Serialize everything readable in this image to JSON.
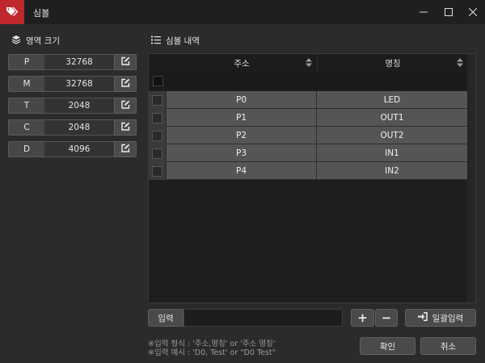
{
  "window": {
    "title": "심볼",
    "accent": "#c0282d"
  },
  "area_section": {
    "title": "영역 크기",
    "rows": [
      {
        "label": "P",
        "value": "32768"
      },
      {
        "label": "M",
        "value": "32768"
      },
      {
        "label": "T",
        "value": "2048"
      },
      {
        "label": "C",
        "value": "2048"
      },
      {
        "label": "D",
        "value": "4096"
      }
    ]
  },
  "symbol_section": {
    "title": "심볼 내역",
    "columns": [
      "주소",
      "명칭"
    ],
    "rows": [
      {
        "address": "P0",
        "name": "LED"
      },
      {
        "address": "P1",
        "name": "OUT1"
      },
      {
        "address": "P2",
        "name": "OUT2"
      },
      {
        "address": "P3",
        "name": "IN1"
      },
      {
        "address": "P4",
        "name": "IN2"
      }
    ]
  },
  "input": {
    "label": "입력",
    "value": ""
  },
  "buttons": {
    "add": "+",
    "remove": "−",
    "bulk_input": "일괄입력",
    "ok": "확인",
    "cancel": "취소"
  },
  "hints": {
    "format": "※입력 형식 : '주소,명칭' or '주소 명칭'",
    "example": "※입력 예시 : 'D0, Test' or \"D0 Test\""
  },
  "icons": {
    "app": "tags-icon",
    "area": "layers-icon",
    "list": "list-icon",
    "edit": "edit-icon",
    "bulk": "sign-in-icon"
  }
}
